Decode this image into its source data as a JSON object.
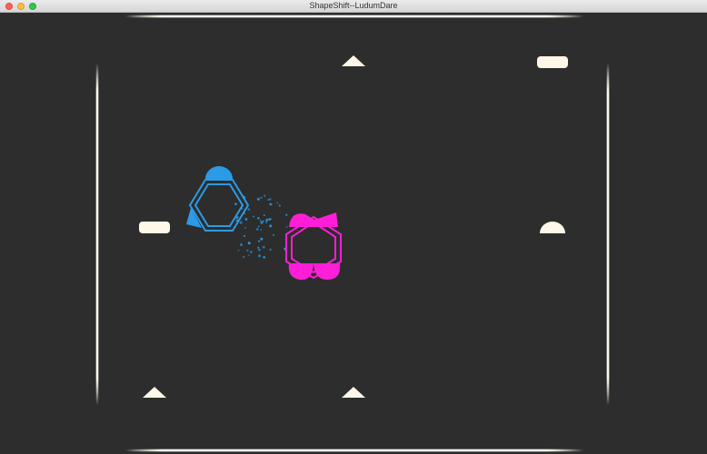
{
  "window": {
    "title": "ShapeShift--LudumDare"
  },
  "game": {
    "background_color": "#2d2d2d",
    "wall_color": "#fffaf0",
    "pickup_color": "#fff8e8",
    "player_blue": {
      "name": "blue-player",
      "color": "#2b9be6",
      "shape": "hexagon"
    },
    "player_magenta": {
      "name": "magenta-player",
      "color": "#ff1ed8",
      "shape": "hexagon"
    },
    "pickups": [
      {
        "name": "triangle-pickup-top",
        "shape": "triangle"
      },
      {
        "name": "rounded-rect-pickup-top-right",
        "shape": "rounded-rect"
      },
      {
        "name": "rounded-rect-pickup-left",
        "shape": "rounded-rect"
      },
      {
        "name": "half-circle-pickup-right",
        "shape": "half-circle"
      },
      {
        "name": "triangle-pickup-bottom-left",
        "shape": "triangle"
      },
      {
        "name": "triangle-pickup-bottom-center",
        "shape": "triangle"
      }
    ]
  }
}
